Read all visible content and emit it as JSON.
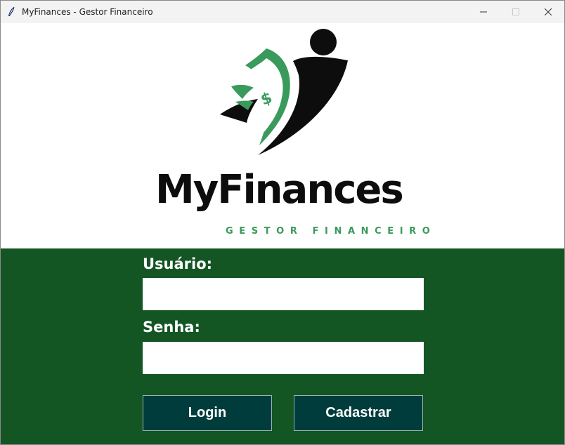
{
  "window": {
    "title": "MyFinances - Gestor Financeiro",
    "icon": "feather-icon",
    "controls": [
      "minimize-icon",
      "maximize-icon",
      "close-icon"
    ]
  },
  "brand": {
    "name": "MyFinances",
    "tagline": "GESTOR FINANCEIRO",
    "logo_icon": "money-person-logo",
    "colors": {
      "green": "#3a9a5c",
      "dark": "#0d0d0d"
    }
  },
  "login": {
    "background": "#145524",
    "username_label": "Usuário:",
    "username_value": "",
    "password_label": "Senha:",
    "password_value": "",
    "login_button": "Login",
    "register_button": "Cadastrar",
    "button_color": "#003c3c"
  }
}
